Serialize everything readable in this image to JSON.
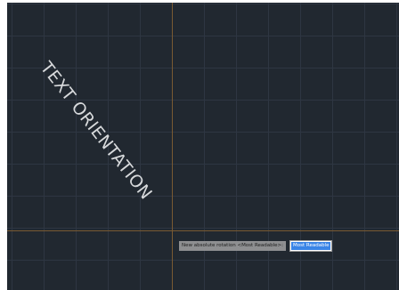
{
  "canvas": {
    "drawing_text": "TEXT ORIENTATION",
    "background_color": "#212830",
    "crosshair_color": "#7a5a32"
  },
  "prompt": {
    "label": "New absolute rotation <Most Readable>:",
    "input_value": "Most Readable"
  }
}
